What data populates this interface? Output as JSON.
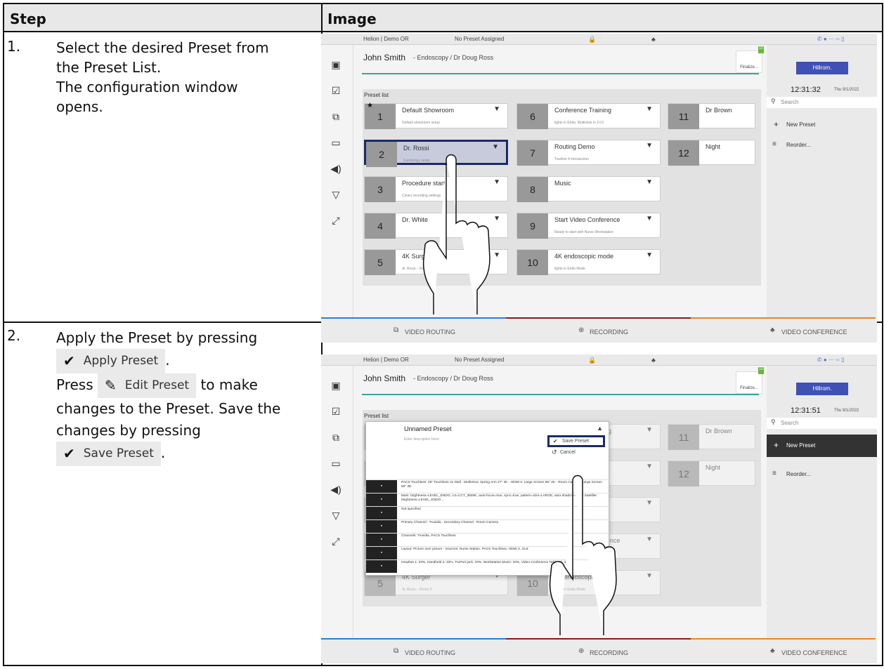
{
  "table": {
    "header_step": "Step",
    "header_image": "Image"
  },
  "steps": [
    {
      "number": "1.",
      "lines": [
        "Select the desired Preset from",
        "the Preset List.",
        "The configuration window",
        "opens."
      ]
    },
    {
      "number": "2.",
      "line1": "Apply the Preset by pressing",
      "apply_button": "Apply Preset",
      "line2a": "Press",
      "edit_button": "Edit Preset",
      "line2b": "to make",
      "line3": "changes to the Preset. Save the",
      "line4": "changes by pressing",
      "save_button": "Save Preset"
    }
  ],
  "screen": {
    "status_left": "Helion | Demo OR",
    "status_preset": "No Preset Assigned",
    "patient": "John Smith",
    "procedure": "- Endoscopy / Dr Doug Ross",
    "finalize": "Finalize...",
    "badge": "10",
    "brand": "Hillrom.",
    "preset_list": "Preset list",
    "search": "Search",
    "new_preset": "New Preset",
    "reorder": "Reorder...",
    "nav": [
      "VIDEO ROUTING",
      "RECORDING",
      "VIDEO CONFERENCE"
    ],
    "times": [
      "12:31:32",
      "12:31:51"
    ],
    "date": "Thu 9/1/2022"
  },
  "presets": [
    {
      "n": "1",
      "name": "Default Showroom",
      "desc": "Default showroom setup"
    },
    {
      "n": "2",
      "name": "Dr. Rossi",
      "desc": "Cardiology setup"
    },
    {
      "n": "3",
      "name": "Procedure start",
      "desc": "Clears recording settings"
    },
    {
      "n": "4",
      "name": "Dr. White",
      "desc": ""
    },
    {
      "n": "5",
      "name": "4K Surger",
      "desc": "dr. Rossi – Room 5"
    },
    {
      "n": "6",
      "name": "Conference Training",
      "desc": "lights in Endo, Multiview in 1½3"
    },
    {
      "n": "7",
      "name": "Routing Demo",
      "desc": "Truelink 4 introduction"
    },
    {
      "n": "8",
      "name": "Music",
      "desc": ""
    },
    {
      "n": "9",
      "name": "Start Video Conference",
      "desc": "Ready to start with Nurse Workstation"
    },
    {
      "n": "10",
      "name": "4K endoscopic mode",
      "desc": "lights in Endo Mode"
    },
    {
      "n": "11",
      "name": "Dr Brown",
      "desc": ""
    },
    {
      "n": "12",
      "name": "Night",
      "desc": ""
    }
  ],
  "edit": {
    "title": "Unnamed Preset",
    "placeholder": "Enter description here!",
    "save": "Save Preset",
    "cancel": "Cancel",
    "rows": [
      "PACS Touchless: 46\" Touchless on Wall - MultiView: Spring Arm 27\" 4K - HDMI 2: Large Screen 55\" 4K - Room Camera: Large Screen 50\" 3D",
      "Main: brightness=LEVEL_ENDO, cct=CCT_3500K, auto-focus=true, sync=true, pattern=size=LARGE, auto-shadow=true - Satellite: brightness=LEVEL_ENDO...",
      "Not specified",
      "Primary Channel : Truvidia - Secondary Channel : Room Camera",
      "Channels: Truvidia, PACS Touchless",
      "Layout: Picture over picture - Sources: Nurse Station, PACS Touchless, HDMI 2, GL8",
      "Headset 1: 33%, Handheld 2: 33%, TruPort jack: 33%, Workstation Music: 33%, Video Conference Talkback: 34%"
    ]
  },
  "colors": {
    "selected": "#1a2b66",
    "brand": "#3f51b5",
    "accent_blue": "#2b7fd8",
    "accent_red": "#8b1a1a",
    "accent_orange": "#e8862a"
  }
}
